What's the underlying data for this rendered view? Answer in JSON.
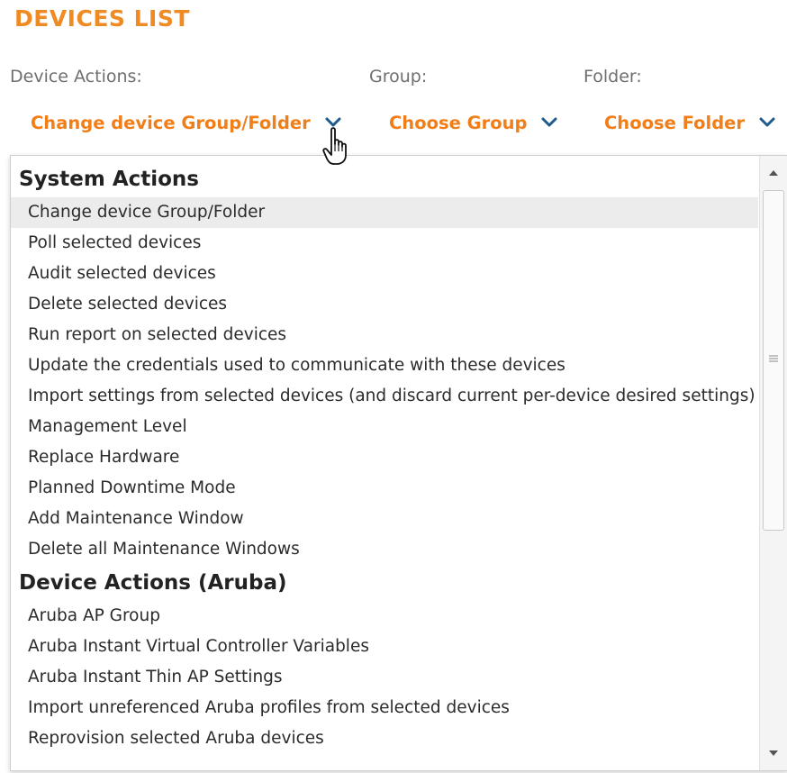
{
  "header": {
    "title": "DEVICES LIST"
  },
  "filters": {
    "device_actions": {
      "label": "Device Actions:",
      "value": "Change device Group/Folder"
    },
    "group": {
      "label": "Group:",
      "value": "Choose Group"
    },
    "folder": {
      "label": "Folder:",
      "value": "Choose Folder"
    }
  },
  "dropdown": {
    "groups": [
      {
        "header": "System Actions",
        "options": [
          "Change device Group/Folder",
          "Poll selected devices",
          "Audit selected devices",
          "Delete selected devices",
          "Run report on selected devices",
          "Update the credentials used to communicate with these devices",
          "Import settings from selected devices (and discard current per-device desired settings)",
          "Management Level",
          "Replace Hardware",
          "Planned Downtime Mode",
          "Add Maintenance Window",
          "Delete all Maintenance Windows"
        ]
      },
      {
        "header": "Device Actions (Aruba)",
        "options": [
          "Aruba AP Group",
          "Aruba Instant Virtual Controller Variables",
          "Aruba Instant Thin AP Settings",
          "Import unreferenced Aruba profiles from selected devices",
          "Reprovision selected Aruba devices"
        ]
      }
    ],
    "selected_option": "Change device Group/Folder"
  },
  "colors": {
    "accent_orange": "#f08a23",
    "chevron_blue": "#1f5a8c",
    "selected_row": "#ececec"
  },
  "icons": {
    "chevron": "chevron-down-icon",
    "cursor": "hand-pointer-icon",
    "scroll_up": "scroll-up-arrow-icon",
    "scroll_down": "scroll-down-arrow-icon"
  }
}
